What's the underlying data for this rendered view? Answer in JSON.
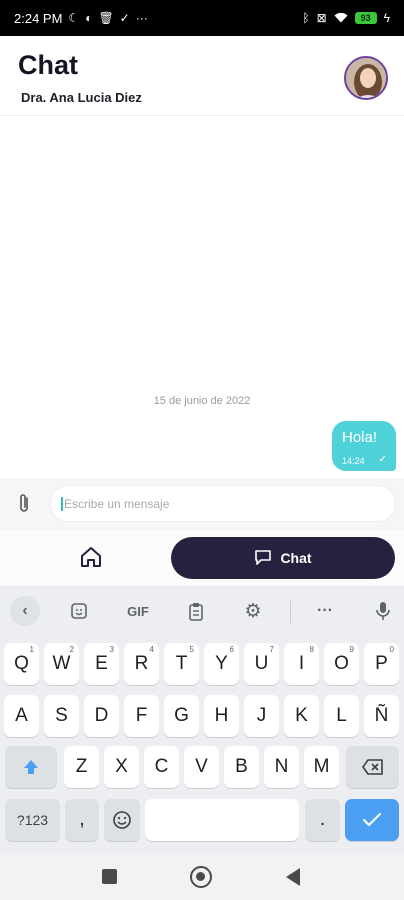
{
  "status_bar": {
    "time": "2:24 PM",
    "left_icons": [
      "moon-icon",
      "data-saver-icon",
      "trash-icon",
      "download-done-icon",
      "more-dots-icon"
    ],
    "right_icons": [
      "bluetooth-icon",
      "no-sim-icon",
      "wifi-icon",
      "battery-icon",
      "charging-icon"
    ],
    "battery_level": "93"
  },
  "header": {
    "title": "Chat",
    "subtitle": "Dra. Ana Lucia Diez"
  },
  "chat": {
    "date_separator": "15 de junio de 2022",
    "messages": [
      {
        "text": "Hola!",
        "time": "14:24",
        "status": "✓"
      }
    ]
  },
  "composer": {
    "placeholder": "Escribe un mensaje"
  },
  "bottom_nav": {
    "chat_label": "Chat"
  },
  "keyboard": {
    "toolbar": {
      "gif_label": "GIF"
    },
    "row1": [
      {
        "k": "Q",
        "h": "1"
      },
      {
        "k": "W",
        "h": "2"
      },
      {
        "k": "E",
        "h": "3"
      },
      {
        "k": "R",
        "h": "4"
      },
      {
        "k": "T",
        "h": "5"
      },
      {
        "k": "Y",
        "h": "6"
      },
      {
        "k": "U",
        "h": "7"
      },
      {
        "k": "I",
        "h": "8"
      },
      {
        "k": "O",
        "h": "9"
      },
      {
        "k": "P",
        "h": "0"
      }
    ],
    "row2": [
      "A",
      "S",
      "D",
      "F",
      "G",
      "H",
      "J",
      "K",
      "L",
      "Ñ"
    ],
    "row3": [
      "Z",
      "X",
      "C",
      "V",
      "B",
      "N",
      "M"
    ],
    "symbols_label": "?123",
    "comma_label": ",",
    "period_label": "."
  },
  "colors": {
    "accent": "#4fd1d9",
    "nav_active": "#24223f",
    "enter_key": "#4b9ff2"
  }
}
